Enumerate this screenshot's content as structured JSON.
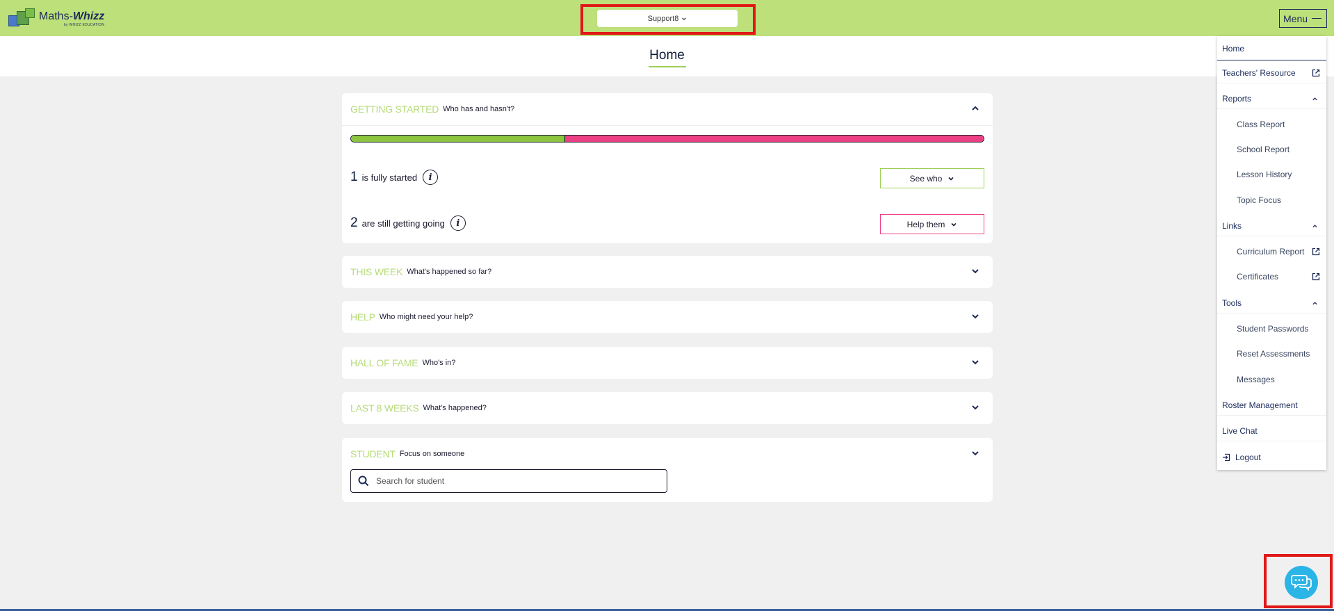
{
  "app": {
    "logo_name": "Maths-",
    "logo_name_bold": "Whizz",
    "logo_sub": "by WHIZZ EDUCATION"
  },
  "header": {
    "class_selector": "Support8",
    "menu_label": "Menu"
  },
  "page": {
    "title": "Home"
  },
  "cards": {
    "getting_started": {
      "title": "GETTING STARTED",
      "subtitle": "Who has and hasn't?",
      "progress_fraction": 0.3384,
      "started_count": "1",
      "started_text": "is fully started",
      "going_count": "2",
      "going_text": "are still getting going",
      "see_who_label": "See who",
      "help_them_label": "Help them"
    },
    "this_week": {
      "title": "THIS WEEK",
      "subtitle": "What's happened so far?"
    },
    "help": {
      "title": "HELP",
      "subtitle": "Who might need your help?"
    },
    "hall_of_fame": {
      "title": "HALL OF FAME",
      "subtitle": "Who's in?"
    },
    "last_8_weeks": {
      "title": "LAST 8 WEEKS",
      "subtitle": "What's happened?"
    },
    "student": {
      "title": "STUDENT",
      "subtitle": "Focus on someone",
      "search_placeholder": "Search for student"
    }
  },
  "side_menu": {
    "home": "Home",
    "teachers_resource": "Teachers' Resource",
    "reports": "Reports",
    "class_report": "Class Report",
    "school_report": "School Report",
    "lesson_history": "Lesson History",
    "topic_focus": "Topic Focus",
    "links": "Links",
    "curriculum_report": "Curriculum Report",
    "certificates": "Certificates",
    "tools": "Tools",
    "student_passwords": "Student Passwords",
    "reset_assessments": "Reset Assessments",
    "messages": "Messages",
    "roster_management": "Roster Management",
    "live_chat": "Live Chat",
    "logout": "Logout"
  },
  "colors": {
    "topbar": "#bde07a",
    "accent_green": "#8cc63f",
    "accent_pink": "#ed3f84",
    "navy": "#1c2b5a",
    "chat_blue": "#2bb4e6",
    "highlight_red": "#e01818"
  },
  "icons": {
    "menu": "hamburger-icon",
    "info": "info-icon",
    "search": "search-icon",
    "external": "external-link-icon",
    "chat": "chat-bubbles-icon",
    "logout": "logout-icon"
  }
}
